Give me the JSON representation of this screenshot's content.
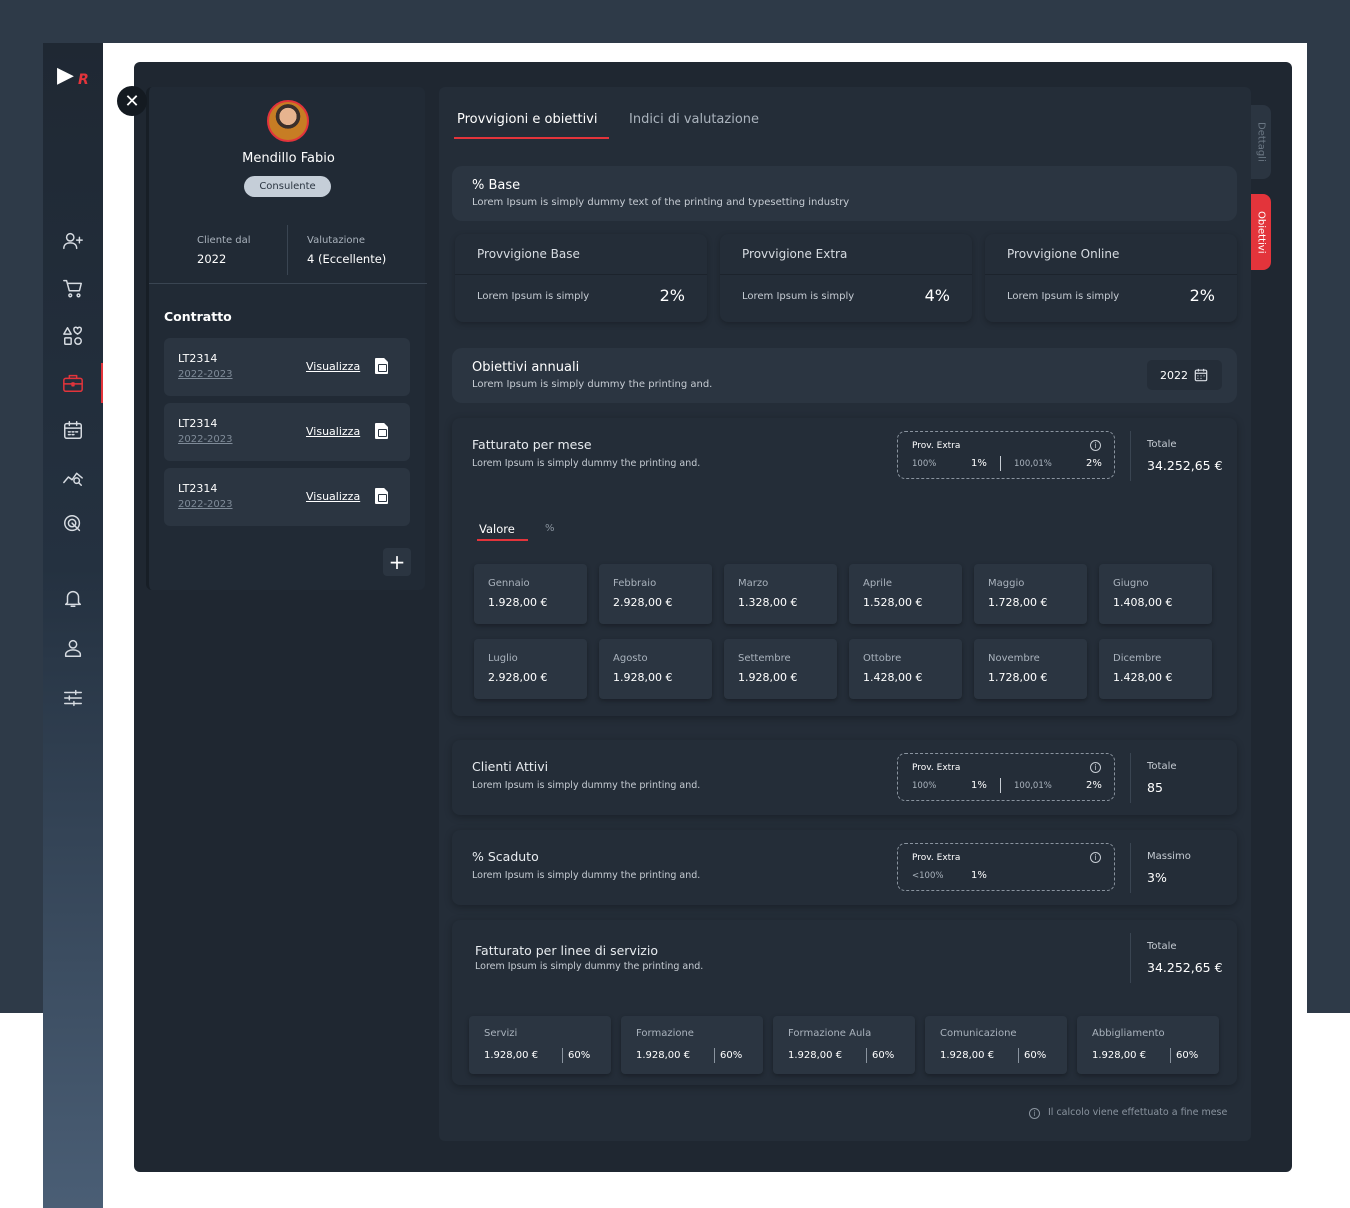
{
  "logo": {
    "text": "R"
  },
  "nav": [
    "add-user-icon",
    "cart-icon",
    "categories-icon",
    "briefcase-icon",
    "calendar-icon",
    "analytics-icon",
    "target-icon",
    "bell-icon",
    "user-icon",
    "settings-sliders-icon"
  ],
  "profile": {
    "name": "Mendillo Fabio",
    "role": "Consulente",
    "client_since_label": "Cliente dal",
    "client_since": "2022",
    "rating_label": "Valutazione",
    "rating": "4 (Eccellente)"
  },
  "contract": {
    "title": "Contratto",
    "items": [
      {
        "code": "LT2314",
        "period": "2022-2023",
        "action": "Visualizza"
      },
      {
        "code": "LT2314",
        "period": "2022-2023",
        "action": "Visualizza"
      },
      {
        "code": "LT2314",
        "period": "2022-2023",
        "action": "Visualizza"
      }
    ],
    "add": "+"
  },
  "tabs": [
    "Provvigioni e obiettivi",
    "Indici di valutazione"
  ],
  "side_tabs": [
    "Dettagli",
    "Obiettivi"
  ],
  "base": {
    "title": "% Base",
    "desc": "Lorem Ipsum is simply dummy text of the printing and typesetting industry"
  },
  "provvigioni": [
    {
      "title": "Provvigione Base",
      "desc": "Lorem Ipsum is simply",
      "value": "2%"
    },
    {
      "title": "Provvigione Extra",
      "desc": "Lorem Ipsum is simply",
      "value": "4%"
    },
    {
      "title": "Provvigione Online",
      "desc": "Lorem Ipsum is simply",
      "value": "2%"
    }
  ],
  "obiettivi": {
    "title": "Obiettivi annuali",
    "desc": "Lorem Ipsum is simply dummy the printing and.",
    "year": "2022"
  },
  "fatturato": {
    "title": "Fatturato per mese",
    "desc": "Lorem Ipsum is simply dummy the printing and.",
    "prov": {
      "label": "Prov. Extra",
      "a1": "100%",
      "b1": "1%",
      "a2": "100,01%",
      "b2": "2%"
    },
    "total_label": "Totale",
    "total": "34.252,65 €",
    "tab": "Valore",
    "months": [
      {
        "m": "Gennaio",
        "v": "1.928,00 €"
      },
      {
        "m": "Febbraio",
        "v": "2.928,00 €"
      },
      {
        "m": "Marzo",
        "v": "1.328,00 €"
      },
      {
        "m": "Aprile",
        "v": "1.528,00 €"
      },
      {
        "m": "Maggio",
        "v": "1.728,00 €"
      },
      {
        "m": "Giugno",
        "v": "1.408,00 €"
      },
      {
        "m": "Luglio",
        "v": "2.928,00 €"
      },
      {
        "m": "Agosto",
        "v": "1.928,00 €"
      },
      {
        "m": "Settembre",
        "v": "1.928,00 €"
      },
      {
        "m": "Ottobre",
        "v": "1.428,00 €"
      },
      {
        "m": "Novembre",
        "v": "1.728,00 €"
      },
      {
        "m": "Dicembre",
        "v": "1.428,00 €"
      }
    ]
  },
  "clienti": {
    "title": "Clienti Attivi",
    "desc": "Lorem Ipsum is simply dummy the printing and.",
    "prov": {
      "label": "Prov. Extra",
      "a1": "100%",
      "b1": "1%",
      "a2": "100,01%",
      "b2": "2%"
    },
    "total_label": "Totale",
    "total": "85"
  },
  "scaduto": {
    "title": "% Scaduto",
    "desc": "Lorem Ipsum is simply dummy the printing and.",
    "prov": {
      "label": "Prov. Extra",
      "a1": "<100%",
      "b1": "1%"
    },
    "total_label": "Massimo",
    "total": "3%"
  },
  "linee": {
    "title": "Fatturato per linee di servizio",
    "desc": "Lorem Ipsum is simply dummy the printing and.",
    "total_label": "Totale",
    "total": "34.252,65 €",
    "services": [
      {
        "n": "Servizi",
        "v": "1.928,00 €",
        "p": "60%"
      },
      {
        "n": "Formazione",
        "v": "1.928,00 €",
        "p": "60%"
      },
      {
        "n": "Formazione Aula",
        "v": "1.928,00 €",
        "p": "60%"
      },
      {
        "n": "Comunicazione",
        "v": "1.928,00 €",
        "p": "60%"
      },
      {
        "n": "Abbigliamento",
        "v": "1.928,00 €",
        "p": "60%"
      }
    ]
  },
  "footnote": "Il calcolo viene effettuato a fine mese"
}
